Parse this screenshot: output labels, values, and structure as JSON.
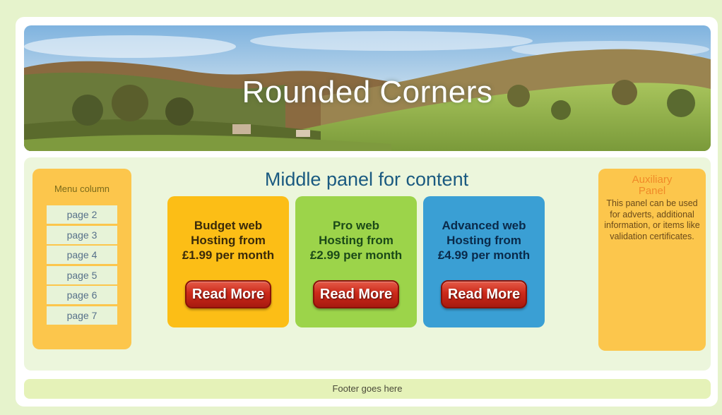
{
  "header": {
    "title": "Rounded Corners"
  },
  "menu": {
    "title": "Menu column",
    "items": [
      "page 2",
      "page 3",
      "page 4",
      "page 5",
      "page 6",
      "page 7"
    ]
  },
  "main": {
    "title": "Middle panel for content",
    "cards": [
      {
        "line1": "Budget web",
        "line2": "Hosting from",
        "line3": "£1.99 per month",
        "button": "Read More",
        "color": "#fcbe16"
      },
      {
        "line1": "Pro web",
        "line2": "Hosting from",
        "line3": "£2.99 per month",
        "button": "Read More",
        "color": "#9cd44a"
      },
      {
        "line1": "Advanced web",
        "line2": "Hosting from",
        "line3": "£4.99 per month",
        "button": "Read More",
        "color": "#3a9fd4"
      }
    ]
  },
  "aux": {
    "title": "Auxiliary Panel",
    "body": "This panel can be used for adverts, additional information, or items like validation certificates."
  },
  "footer": {
    "text": "Footer goes here"
  },
  "colors": {
    "page_background": "#e6f3cc",
    "side_panel": "#fcc64c",
    "content_panel": "#ecf6dc",
    "footer": "#e5f2b8",
    "button": "#cc2a1a"
  }
}
